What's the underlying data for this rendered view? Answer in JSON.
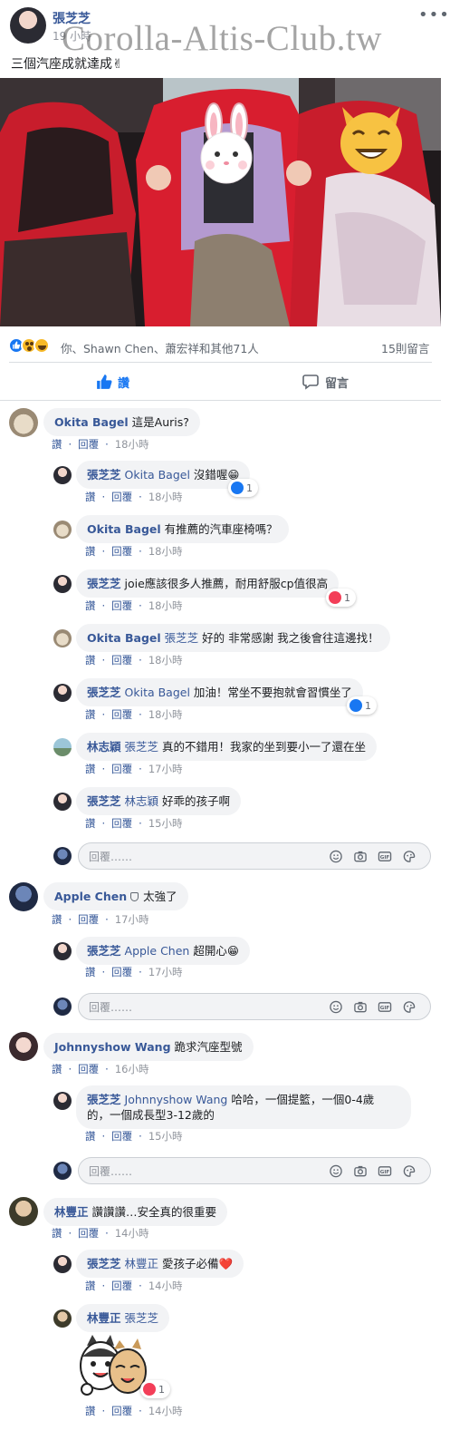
{
  "watermark": "Corolla-Altis-Club.tw",
  "post": {
    "author": "張芝芝",
    "time": "19 小時",
    "text": "三個汽座成就達成✌",
    "more_icon": "ellipsis-icon"
  },
  "reactions": {
    "summary": "你、Shawn Chen、蕭宏祥和其他71人",
    "comments_count": "15則留言"
  },
  "action_bar": {
    "like": "讚",
    "comment": "留言"
  },
  "comment_actions": {
    "like": "讚",
    "reply": "回覆"
  },
  "reply_placeholder": "回覆……",
  "threads": [
    {
      "author": "Okita Bagel",
      "text": "這是Auris?",
      "time": "18小時",
      "replies": [
        {
          "author": "張芝芝",
          "mention": "Okita Bagel",
          "text": "沒錯喔😁",
          "time": "18小時",
          "reaction_count": "1"
        },
        {
          "author": "Okita Bagel",
          "mention": "",
          "text": "有推薦的汽車座椅嗎？",
          "time": "18小時"
        },
        {
          "author": "張芝芝",
          "mention": "",
          "text": "joie應該很多人推薦，耐用舒服cp值很高",
          "time": "18小時",
          "reaction_count": "1"
        },
        {
          "author": "Okita Bagel",
          "mention": "張芝芝",
          "text": "好的 非常感謝 我之後會往這邊找！",
          "time": "18小時"
        },
        {
          "author": "張芝芝",
          "mention": "Okita Bagel",
          "text": "加油！常坐不要抱就會習慣坐了",
          "time": "18小時",
          "reaction_count": "1"
        },
        {
          "author": "林志穎",
          "mention": "張芝芝",
          "text": "真的不錯用！我家的坐到要小一了還在坐",
          "time": "17小時"
        },
        {
          "author": "張芝芝",
          "mention": "林志穎",
          "text": "好乖的孩子啊",
          "time": "15小時"
        }
      ]
    },
    {
      "author": "Apple Chen",
      "text": "太強了",
      "time": "17小時",
      "replies": [
        {
          "author": "張芝芝",
          "mention": "Apple Chen",
          "text": "超開心😁",
          "time": "17小時"
        }
      ]
    },
    {
      "author": "Johnnyshow Wang",
      "text": "跪求汽座型號",
      "time": "16小時",
      "replies": [
        {
          "author": "張芝芝",
          "mention": "Johnnyshow Wang",
          "text": "哈哈，一個提籃，一個0-4歲",
          "text2": "的，一個成長型3-12歲的",
          "time": "15小時"
        }
      ]
    },
    {
      "author": "林豐正",
      "text": "讚讚讚…安全真的很重要",
      "time": "14小時",
      "replies": [
        {
          "author": "張芝芝",
          "mention": "林豐正",
          "text": "愛孩子必備❤️",
          "time": "14小時"
        },
        {
          "author": "林豐正",
          "mention": "張芝芝",
          "text": "",
          "time": "14小時",
          "reaction_count": "1"
        }
      ]
    }
  ],
  "colors": {
    "link": "#385898",
    "facebook_blue": "#1877f2",
    "bubble": "#f2f3f5",
    "muted": "#90949c"
  }
}
